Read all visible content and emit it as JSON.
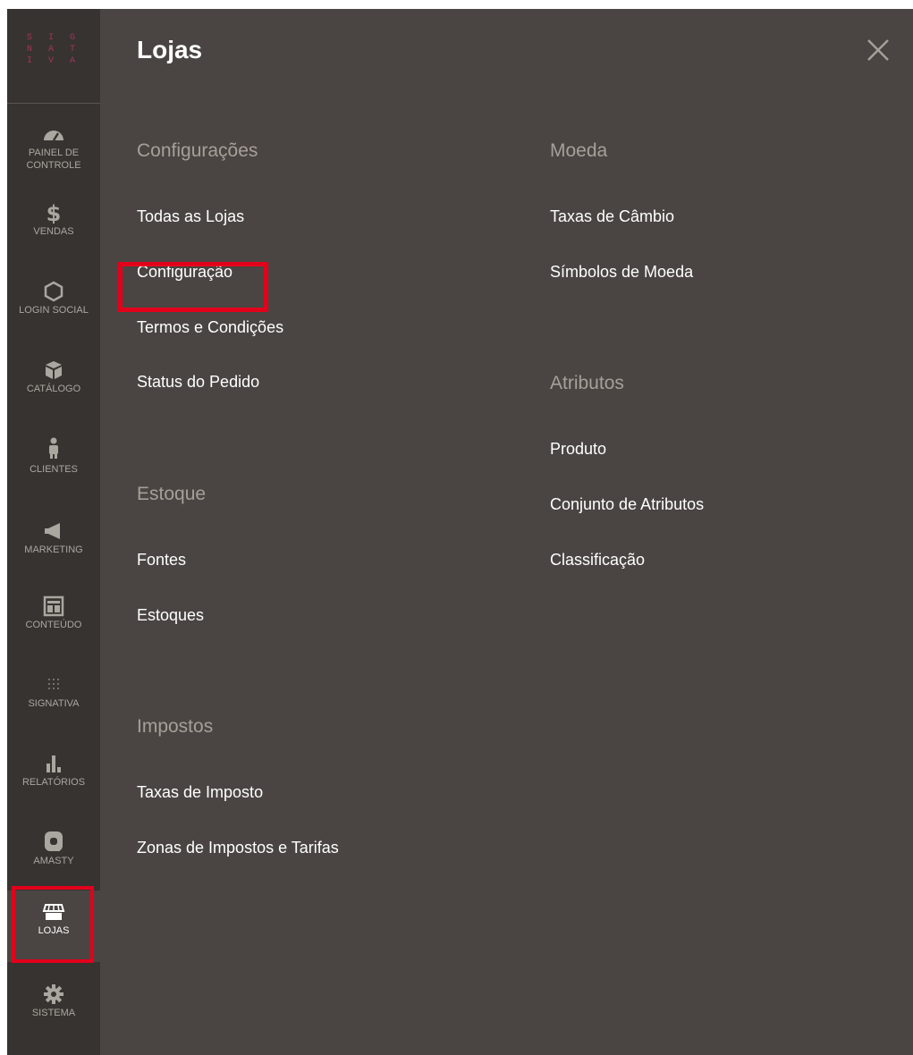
{
  "logo": {
    "rows": [
      "S I G",
      "N A T",
      "I V A"
    ]
  },
  "sidebar": {
    "items": [
      {
        "label": "PAINEL DE\nCONTROLE",
        "label1": "PAINEL DE",
        "label2": "CONTROLE",
        "icon": "dashboard-icon"
      },
      {
        "label": "VENDAS",
        "icon": "dollar-icon"
      },
      {
        "label": "LOGIN SOCIAL",
        "icon": "hexagon-icon"
      },
      {
        "label": "CATÁLOGO",
        "icon": "box-icon"
      },
      {
        "label": "CLIENTES",
        "icon": "person-icon"
      },
      {
        "label": "MARKETING",
        "icon": "megaphone-icon"
      },
      {
        "label": "CONTEÚDO",
        "icon": "layout-icon"
      },
      {
        "label": "SIGNATIVA",
        "icon": "dots-grid-icon"
      },
      {
        "label": "RELATÓRIOS",
        "icon": "bar-chart-icon"
      },
      {
        "label": "AMASTY",
        "icon": "amasty-icon"
      },
      {
        "label": "LOJAS",
        "icon": "store-icon",
        "active": true
      },
      {
        "label": "SISTEMA",
        "icon": "gear-icon"
      }
    ]
  },
  "panel": {
    "title": "Lojas",
    "close_icon": "close-icon",
    "groups": {
      "configuracoes": {
        "title": "Configurações",
        "links": [
          "Todas as Lojas",
          "Configuração",
          "Termos e Condições",
          "Status do Pedido"
        ]
      },
      "estoque": {
        "title": "Estoque",
        "links": [
          "Fontes",
          "Estoques"
        ]
      },
      "impostos": {
        "title": "Impostos",
        "links": [
          "Taxas de Imposto",
          "Zonas de Impostos e Tarifas"
        ]
      },
      "moeda": {
        "title": "Moeda",
        "links": [
          "Taxas de Câmbio",
          "Símbolos de Moeda"
        ]
      },
      "atributos": {
        "title": "Atributos",
        "links": [
          "Produto",
          "Conjunto de Atributos",
          "Classificação"
        ]
      }
    }
  },
  "colors": {
    "sidebar_bg": "#373330",
    "panel_bg": "#4a4542",
    "highlight": "#e3001b",
    "logo": "#a4345a"
  }
}
